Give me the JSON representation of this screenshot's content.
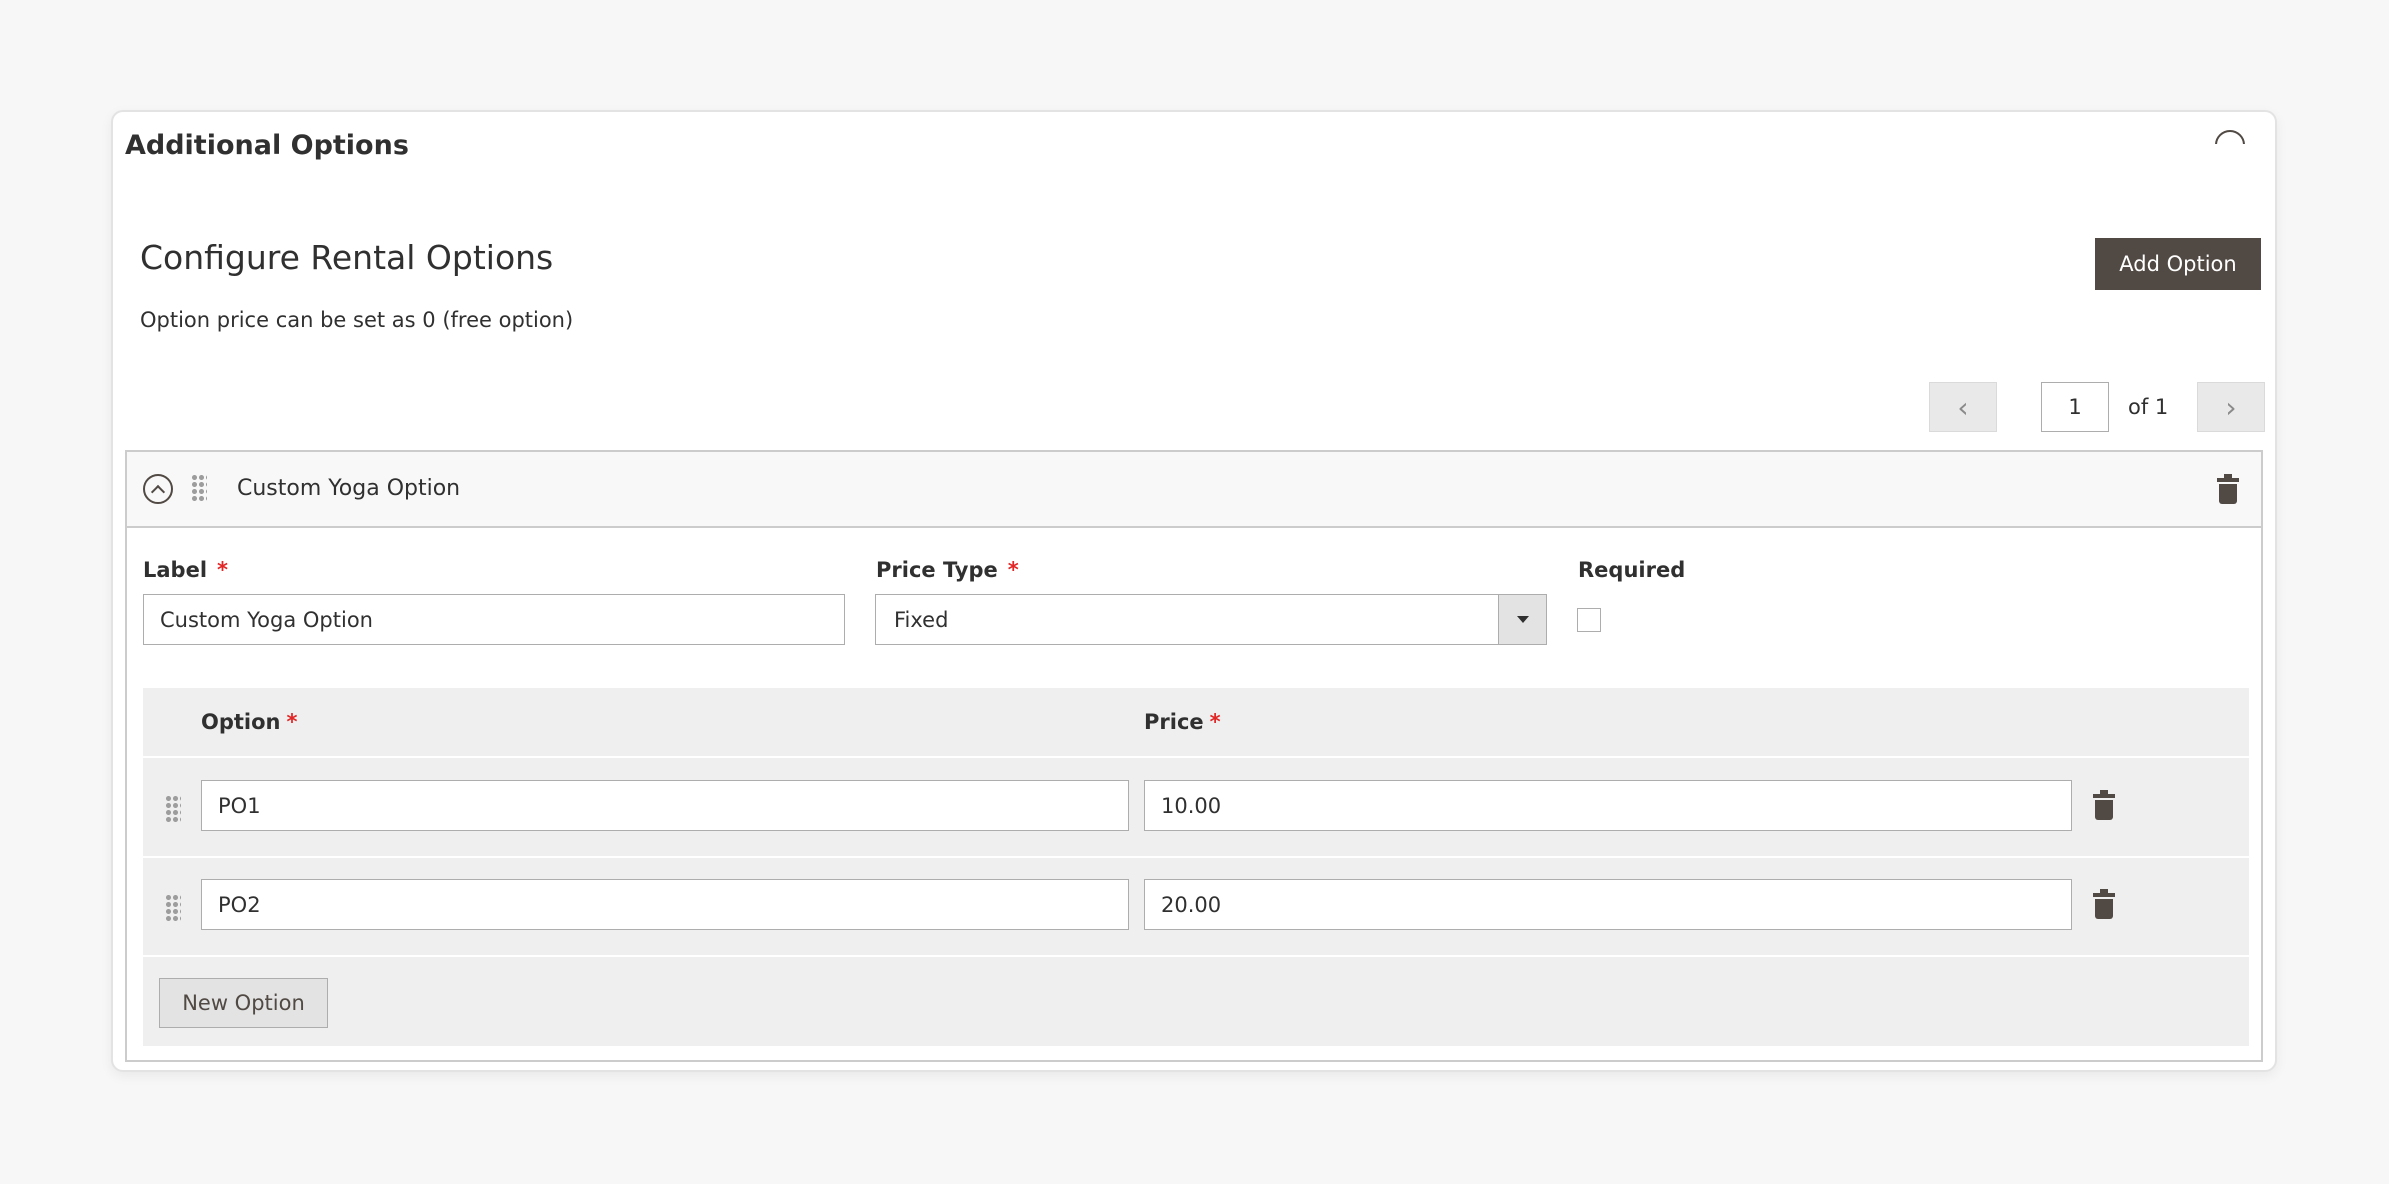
{
  "panel": {
    "title": "Additional Options"
  },
  "section": {
    "title": "Configure Rental Options",
    "note": "Option price can be set as 0 (free option)",
    "add_button": "Add Option"
  },
  "pager": {
    "current_page": "1",
    "total_label": "of 1",
    "prev_icon": "chevron-left-icon",
    "next_icon": "chevron-right-icon"
  },
  "option": {
    "header_title": "Custom Yoga Option",
    "fields": {
      "label_label": "Label",
      "label_value": "Custom Yoga Option",
      "price_type_label": "Price Type",
      "price_type_value": "Fixed",
      "required_label": "Required",
      "required_checked": false,
      "required_marker": "*"
    },
    "grid": {
      "columns": [
        "Option",
        "Price"
      ],
      "rows": [
        {
          "option": "PO1",
          "price": "10.00"
        },
        {
          "option": "PO2",
          "price": "20.00"
        }
      ],
      "new_button": "New Option"
    }
  },
  "colors": {
    "accent": "#514943",
    "required": "#e22626",
    "page_bg": "#f7f7f7"
  }
}
